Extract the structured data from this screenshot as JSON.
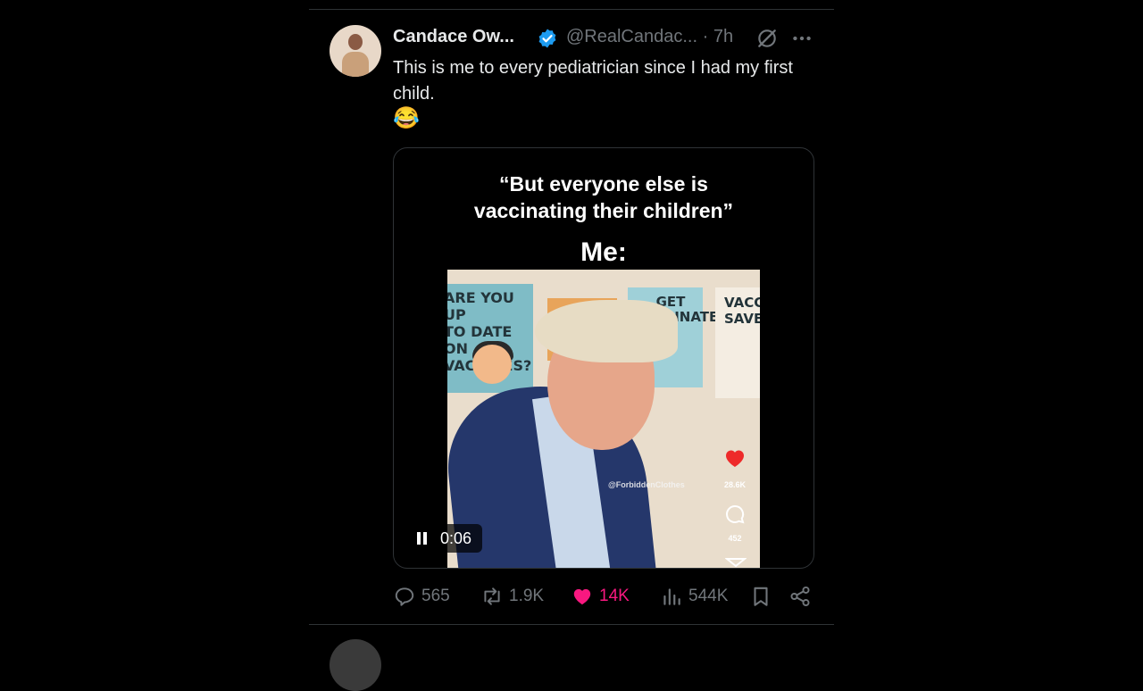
{
  "tweet": {
    "author_name": "Candace Ow...",
    "handle": "@RealCandac... · 7h",
    "text": "This is me to every pediatrician since I had my first child.",
    "emoji": "😂"
  },
  "video": {
    "caption_quote": "“But everyone else is\nvaccinating their children”",
    "caption_me": "Me:",
    "poster_left_text": "ARE YOU UP\nTO DATE ON\nVACCINES?",
    "poster_middle_text": "GET\nVACCINATED",
    "poster_right_text": "VACC\nSAVE",
    "watermark": "@ForbiddenClothes",
    "overlay_likes": "28.6K",
    "overlay_comments": "452",
    "timestamp": "0:06",
    "progress_state": "playing"
  },
  "actions": {
    "replies": "565",
    "reposts": "1.9K",
    "likes": "14K",
    "views": "544K"
  },
  "colors": {
    "background": "#000000",
    "text": "#e7e9ea",
    "muted": "#71767b",
    "verified": "#1d9bf0",
    "like": "#f91880",
    "divider": "#2f3336"
  },
  "icons": [
    "verified-badge-icon",
    "grok-icon",
    "more-icon",
    "pause-icon",
    "reply-icon",
    "repost-icon",
    "like-icon",
    "views-icon",
    "bookmark-icon",
    "share-icon"
  ]
}
